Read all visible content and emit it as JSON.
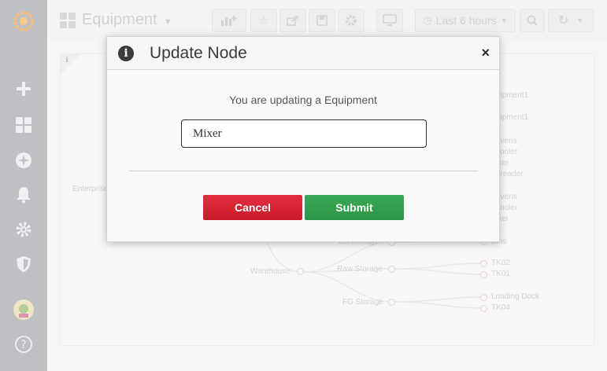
{
  "header": {
    "dashboard_title": "Equipment",
    "time_range": "Last 6 hours"
  },
  "tree": {
    "root": "Enterprise",
    "labels_partial": [
      "uipment1",
      "uipment1",
      "ovens",
      "cooler",
      "ixer",
      "preader",
      "ovens",
      "cooler",
      "ixer",
      "Lift Storage",
      "Bins"
    ],
    "warehouse": "Warehouse",
    "raw_storage": "Raw Storage",
    "fg_storage": "FG Storage",
    "tk02": "TK02",
    "tk01": "TK01",
    "loading_dock": "Loading Dock",
    "tk04": "TK04"
  },
  "modal": {
    "title": "Update Node",
    "message": "You are updating a Equipment",
    "input_value": "Mixer",
    "cancel_label": "Cancel",
    "submit_label": "Submit",
    "close_label": "×"
  },
  "colors": {
    "cancel": "#d92233",
    "submit": "#33a04e",
    "sidebar": "#9c9ea3"
  }
}
